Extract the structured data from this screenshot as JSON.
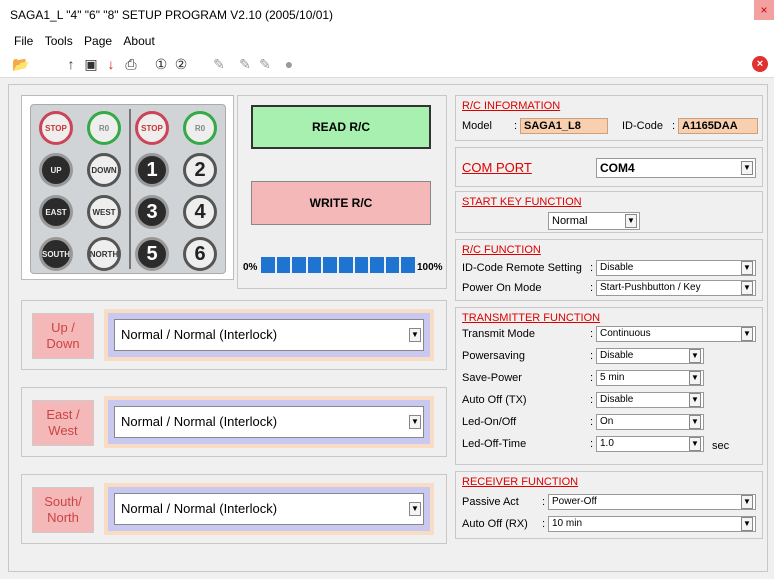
{
  "window": {
    "title": "SAGA1_L \"4\" \"6\" \"8\" SETUP PROGRAM V2.10 (2005/10/01)",
    "close_glyph": "×"
  },
  "menu": [
    "File",
    "Tools",
    "Page",
    "About"
  ],
  "toolbar": {
    "icons": [
      "open-folder-icon",
      "upload-icon",
      "save-icon",
      "download-icon",
      "print-icon",
      "option-1-icon",
      "option-2-icon",
      "pen-1-icon",
      "pen-2-icon",
      "pen-3-icon",
      "record-icon"
    ],
    "close_glyph": "×"
  },
  "keypad": {
    "rows": [
      [
        {
          "t": "STOP",
          "s": "red"
        },
        {
          "t": "R0",
          "s": "green"
        },
        {
          "t": "STOP",
          "s": "red"
        },
        {
          "t": "R0",
          "s": "green"
        }
      ],
      [
        {
          "t": "UP",
          "s": "dark"
        },
        {
          "t": "DOWN",
          "s": "light"
        },
        {
          "t": "1",
          "s": "dark num"
        },
        {
          "t": "2",
          "s": "light num"
        }
      ],
      [
        {
          "t": "EAST",
          "s": "dark"
        },
        {
          "t": "WEST",
          "s": "light"
        },
        {
          "t": "3",
          "s": "dark num"
        },
        {
          "t": "4",
          "s": "light num"
        }
      ],
      [
        {
          "t": "SOUTH",
          "s": "dark"
        },
        {
          "t": "NORTH",
          "s": "light"
        },
        {
          "t": "5",
          "s": "dark num"
        },
        {
          "t": "6",
          "s": "light num"
        }
      ]
    ]
  },
  "actions": {
    "read": "READ R/C",
    "write": "WRITE R/C"
  },
  "progress": {
    "min_label": "0%",
    "max_label": "100%",
    "value": 1.0,
    "segments": 10
  },
  "directions": [
    {
      "label": "Up /\nDown",
      "value": "Normal / Normal (Interlock)"
    },
    {
      "label": "East /\nWest",
      "value": "Normal / Normal (Interlock)"
    },
    {
      "label": "South/\nNorth",
      "value": "Normal / Normal (Interlock)"
    }
  ],
  "rc_info": {
    "title": "R/C INFORMATION",
    "model_label": "Model",
    "model_value": "SAGA1_L8",
    "id_label": "ID-Code",
    "id_value": "A1165DAA"
  },
  "com_port": {
    "title": "COM PORT",
    "value": "COM4"
  },
  "start_key": {
    "title": "START KEY FUNCTION",
    "value": "Normal"
  },
  "rc_function": {
    "title": "R/C FUNCTION",
    "rows": [
      {
        "label": "ID-Code Remote Setting",
        "value": "Disable"
      },
      {
        "label": "Power On Mode",
        "value": "Start-Pushbutton / Key"
      }
    ]
  },
  "transmitter": {
    "title": "TRANSMITTER FUNCTION",
    "rows": [
      {
        "label": "Transmit Mode",
        "value": "Continuous"
      },
      {
        "label": "Powersaving",
        "value": "Disable"
      },
      {
        "label": "Save-Power",
        "value": "5 min"
      },
      {
        "label": "Auto Off (TX)",
        "value": "Disable"
      },
      {
        "label": "Led-On/Off",
        "value": "On"
      },
      {
        "label": "Led-Off-Time",
        "value": "1.0"
      }
    ],
    "unit": "sec"
  },
  "receiver": {
    "title": "RECEIVER FUNCTION",
    "rows": [
      {
        "label": "Passive Act",
        "value": "Power-Off"
      },
      {
        "label": "Auto Off (RX)",
        "value": "10 min"
      }
    ]
  },
  "colon": ":",
  "dd_glyph": "▼"
}
